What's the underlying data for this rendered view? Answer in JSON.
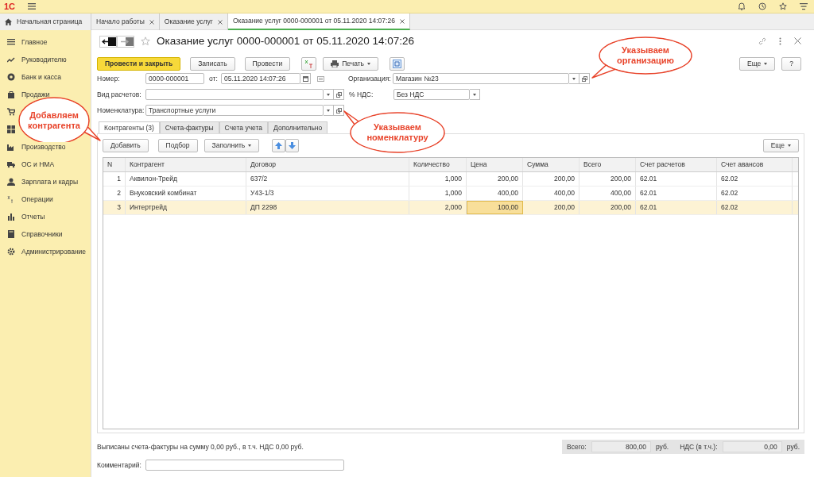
{
  "app": {
    "logo": "1С"
  },
  "open_tabs": [
    {
      "label": "Начальная страница",
      "selected": false,
      "closable": false
    },
    {
      "label": "Начало работы",
      "selected": false,
      "closable": true
    },
    {
      "label": "Оказание услуг",
      "selected": false,
      "closable": true
    },
    {
      "label": "Оказание услуг 0000-000001 от 05.11.2020 14:07:26",
      "selected": true,
      "closable": true
    }
  ],
  "sidebar": {
    "items": [
      {
        "kind": "entry",
        "label": "Главное"
      },
      {
        "kind": "entry",
        "label": "Руководителю"
      },
      {
        "kind": "entry",
        "label": "Банк и касса"
      },
      {
        "kind": "entry",
        "label": "Продажи"
      },
      {
        "kind": "icon_only"
      },
      {
        "kind": "icon_only"
      },
      {
        "kind": "entry",
        "label": "Производство"
      },
      {
        "kind": "entry",
        "label": "ОС и НМА"
      },
      {
        "kind": "entry",
        "label": "Зарплата и кадры"
      },
      {
        "kind": "entry",
        "label": "Операции"
      },
      {
        "kind": "entry",
        "label": "Отчеты"
      },
      {
        "kind": "entry",
        "label": "Справочники"
      },
      {
        "kind": "entry",
        "label": "Администрирование"
      }
    ]
  },
  "form": {
    "title": "Оказание услуг 0000-000001 от 05.11.2020 14:07:26",
    "favorite": false,
    "toolbar": [
      {
        "kind": "primary",
        "label": "Провести и закрыть"
      },
      {
        "kind": "default",
        "label": "Записать"
      },
      {
        "kind": "default",
        "label": "Провести"
      },
      {
        "kind": "dtkt"
      },
      {
        "kind": "print",
        "label": "Печать"
      },
      {
        "kind": "structure"
      }
    ],
    "more_button": "Еще",
    "help_button": "?",
    "number_label": "Номер:",
    "number": "0000-000001",
    "date_label": "от:",
    "date": "05.11.2020 14:07:26",
    "organization_label": "Организация:",
    "organization": "Магазин №23",
    "payment_type_label": "Вид расчетов:",
    "vat_label": "% НДС:",
    "vat": "Без НДС",
    "nomenclature_label": "Номенклатура:",
    "nomenclature": "Транспортные услуги",
    "tabs": [
      {
        "label": "Контрагенты (3)",
        "selected": true
      },
      {
        "label": "Счета-фактуры",
        "selected": false
      },
      {
        "label": "Счета учета",
        "selected": false
      },
      {
        "label": "Дополнительно",
        "selected": false
      }
    ],
    "table_toolbar": {
      "add": "Добавить",
      "pick": "Подбор",
      "fill": "Заполнить",
      "more": "Еще"
    },
    "table": {
      "columns": [
        "N",
        "Контрагент",
        "Договор",
        "Количество",
        "Цена",
        "Сумма",
        "Всего",
        "Счет расчетов",
        "Счет авансов"
      ],
      "rows": [
        {
          "selected": false,
          "cells": [
            "1",
            "Аквилон-Трейд",
            "637/2",
            "1,000",
            "200,00",
            "200,00",
            "200,00",
            "62.01",
            "62.02"
          ]
        },
        {
          "selected": false,
          "cells": [
            "2",
            "Внуковский комбинат",
            "У43-1/3",
            "1,000",
            "400,00",
            "400,00",
            "400,00",
            "62.01",
            "62.02"
          ]
        },
        {
          "selected": true,
          "cells": [
            "3",
            "Интертрейд",
            "ДП 2298",
            "2,000",
            "100,00",
            "200,00",
            "200,00",
            "62.01",
            "62.02"
          ]
        }
      ]
    },
    "invoice_note": "Выписаны счета-фактуры на сумму 0,00 руб., в т.ч. НДС 0,00 руб.",
    "totals": {
      "total_label": "Всего:",
      "total": "800,00",
      "currency": "руб.",
      "vat_label": "НДС (в т.ч.):",
      "vat": "0,00",
      "vat_currency": "руб."
    },
    "comment_label": "Комментарий:"
  },
  "callouts": [
    {
      "text": "Указываем\nорганизацию"
    },
    {
      "text": "Добавляем\nконтрагента"
    },
    {
      "text": "Указываем\nноменклатуру"
    }
  ]
}
